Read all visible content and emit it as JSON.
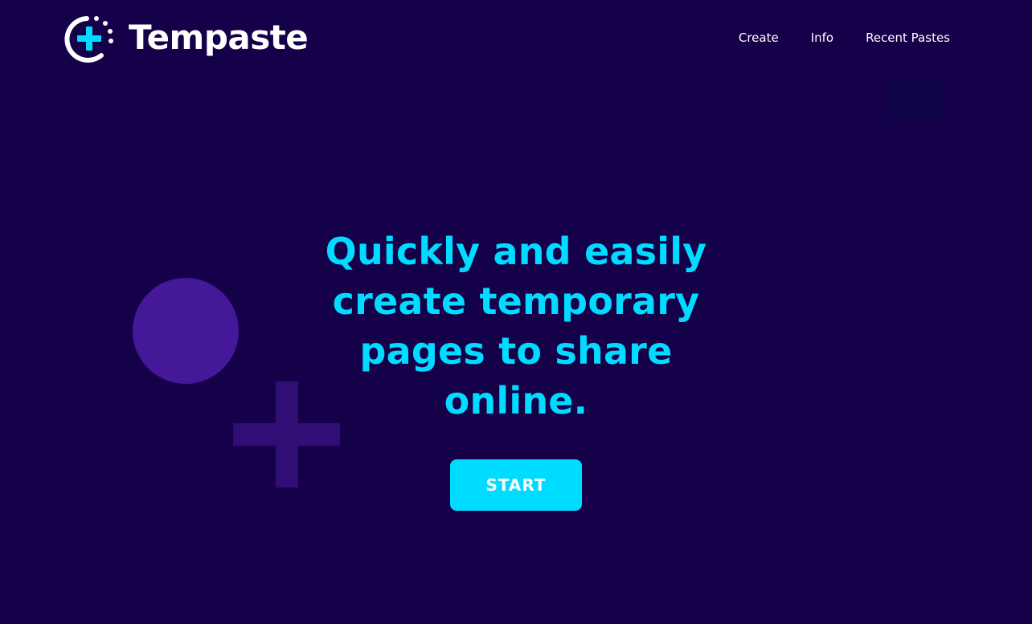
{
  "header": {
    "logo_text": "Tempaste",
    "logo_icon": "plus-clock-icon",
    "nav": [
      {
        "label": "Create"
      },
      {
        "label": "Info"
      },
      {
        "label": "Recent Pastes"
      }
    ]
  },
  "hero": {
    "lines": [
      "Quickly and easily",
      "create temporary",
      "pages to share",
      "online."
    ],
    "cta_label": "START"
  },
  "decorations": {
    "shapes": [
      "circle-shape",
      "plus-shape",
      "square-shape"
    ]
  },
  "colors": {
    "background": "#15004a",
    "accent": "#00dcff",
    "white": "#ffffff",
    "circle": "#45189a",
    "plus": "#300e76"
  }
}
